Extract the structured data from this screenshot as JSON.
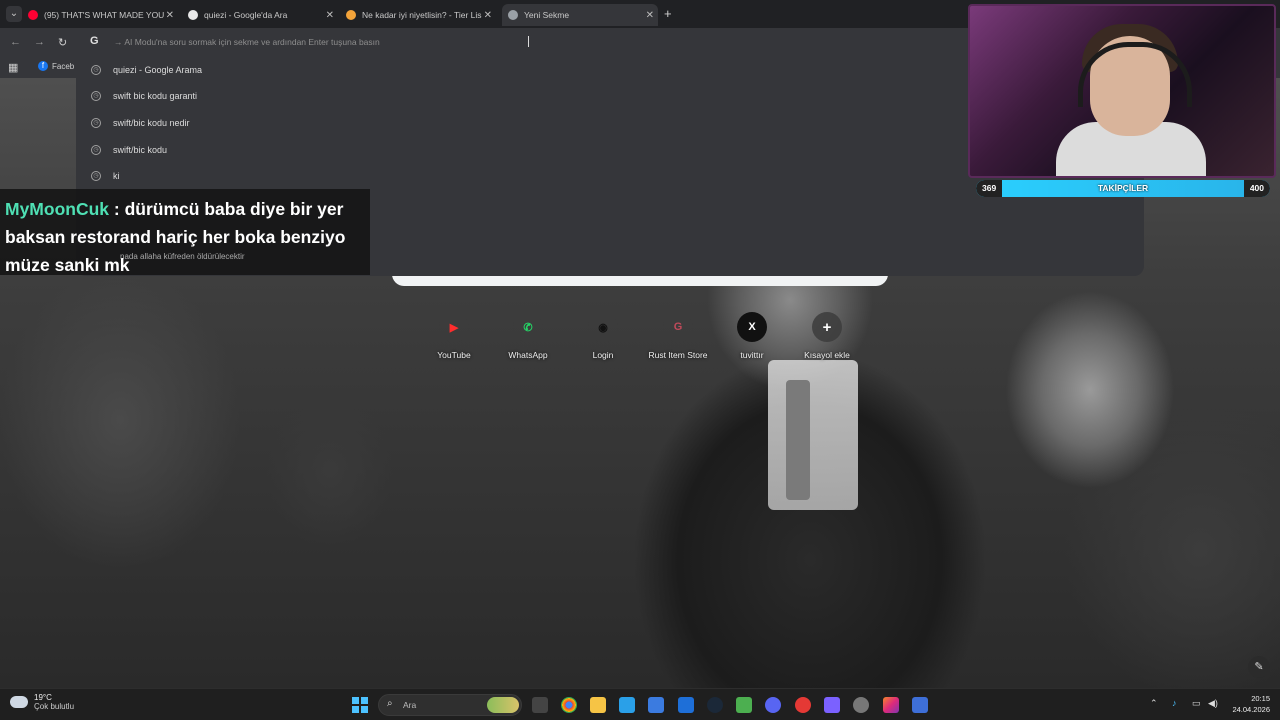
{
  "tabs": [
    {
      "title": "(95) THAT'S WHAT MADE YOU T",
      "favicon": "youtube-icon",
      "color": "#ff0033"
    },
    {
      "title": "quiezi - Google'da Ara",
      "favicon": "google-icon",
      "color": "#e8e8e8"
    },
    {
      "title": "Ne kadar iyi niyetlisin? - Tier Lis",
      "favicon": "tierlist-icon",
      "color": "#f2a33a"
    },
    {
      "title": "Yeni Sekme",
      "favicon": "chrome-icon",
      "color": "#9aa0a6"
    }
  ],
  "omnibox": {
    "placeholder": "→ AI Modu'na soru sormak için sekme ve ardından Enter tuşuna basın",
    "suggestions": [
      "quiezi - Google Arama",
      "swift bic kodu garanti",
      "swift/bic kodu nedir",
      "swift/bic kodu",
      "ki"
    ]
  },
  "bookmarks": {
    "facebook": "Faceb"
  },
  "chat": {
    "user": "MyMoonCuk",
    "separator": ":",
    "message": "dürümcü baba diye bir yer baksan restorand hariç her boka benziyo müze sanki mk",
    "underlay": "nada allaha küfreden öldürülecektir"
  },
  "shortcuts": [
    {
      "label": "YouTube",
      "glyph": "▶",
      "color": "#ff2d2d"
    },
    {
      "label": "WhatsApp",
      "glyph": "✆",
      "color": "#25d366"
    },
    {
      "label": "Login",
      "glyph": "◉",
      "color": "#111111"
    },
    {
      "label": "Rust Item Store",
      "glyph": "G",
      "color": "#c04a5a"
    },
    {
      "label": "tuvittır",
      "glyph": "X",
      "color": "#ffffff"
    },
    {
      "label": "Kısayol ekle",
      "glyph": "+",
      "color": "#ffffff"
    }
  ],
  "followers": {
    "current": "369",
    "label": "TAKİPÇİLER",
    "goal": "400"
  },
  "taskbar": {
    "temperature": "19°C",
    "condition": "Çok bulutlu",
    "search_placeholder": "Ara",
    "time": "20:15",
    "date": "24.04.2026"
  },
  "colors": {
    "accent": "#4fe0b4",
    "bar": "#2ad0ff",
    "windows": "#4cc2ff"
  }
}
